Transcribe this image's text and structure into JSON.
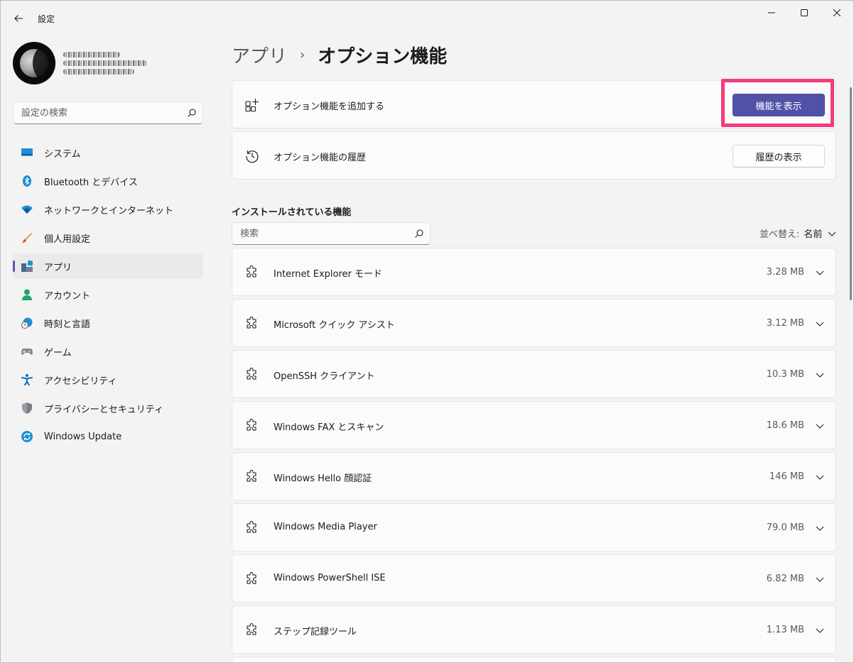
{
  "window": {
    "title": "設定"
  },
  "sidebar": {
    "search_placeholder": "設定の検索",
    "items": [
      {
        "label": "システム",
        "icon": "monitor-icon"
      },
      {
        "label": "Bluetooth とデバイス",
        "icon": "bluetooth-icon"
      },
      {
        "label": "ネットワークとインターネット",
        "icon": "wifi-icon"
      },
      {
        "label": "個人用設定",
        "icon": "brush-icon"
      },
      {
        "label": "アプリ",
        "icon": "apps-icon",
        "active": true
      },
      {
        "label": "アカウント",
        "icon": "person-icon"
      },
      {
        "label": "時刻と言語",
        "icon": "globe-clock-icon"
      },
      {
        "label": "ゲーム",
        "icon": "gamepad-icon"
      },
      {
        "label": "アクセシビリティ",
        "icon": "accessibility-icon"
      },
      {
        "label": "プライバシーとセキュリティ",
        "icon": "shield-icon"
      },
      {
        "label": "Windows Update",
        "icon": "update-icon"
      }
    ]
  },
  "main": {
    "breadcrumb": {
      "parent": "アプリ",
      "separator": "›",
      "current": "オプション機能"
    },
    "add_feature": {
      "label": "オプション機能を追加する",
      "button": "機能を表示"
    },
    "history": {
      "label": "オプション機能の履歴",
      "button": "履歴の表示"
    },
    "installed": {
      "title": "インストールされている機能",
      "search_placeholder": "検索",
      "sort_label": "並べ替え:",
      "sort_value": "名前",
      "features": [
        {
          "name": "Internet Explorer モード",
          "size": "3.28 MB"
        },
        {
          "name": "Microsoft クイック アシスト",
          "size": "3.12 MB"
        },
        {
          "name": "OpenSSH クライアント",
          "size": "10.3 MB"
        },
        {
          "name": "Windows FAX とスキャン",
          "size": "18.6 MB"
        },
        {
          "name": "Windows Hello 顔認証",
          "size": "146 MB"
        },
        {
          "name": "Windows Media Player",
          "size": "79.0 MB"
        },
        {
          "name": "Windows PowerShell ISE",
          "size": "6.82 MB"
        },
        {
          "name": "ステップ記録ツール",
          "size": "1.13 MB"
        }
      ]
    }
  },
  "colors": {
    "accent": "#5151a8",
    "highlight": "#f23c7b",
    "background": "#f3f3f3",
    "card": "#fbfbfb"
  }
}
